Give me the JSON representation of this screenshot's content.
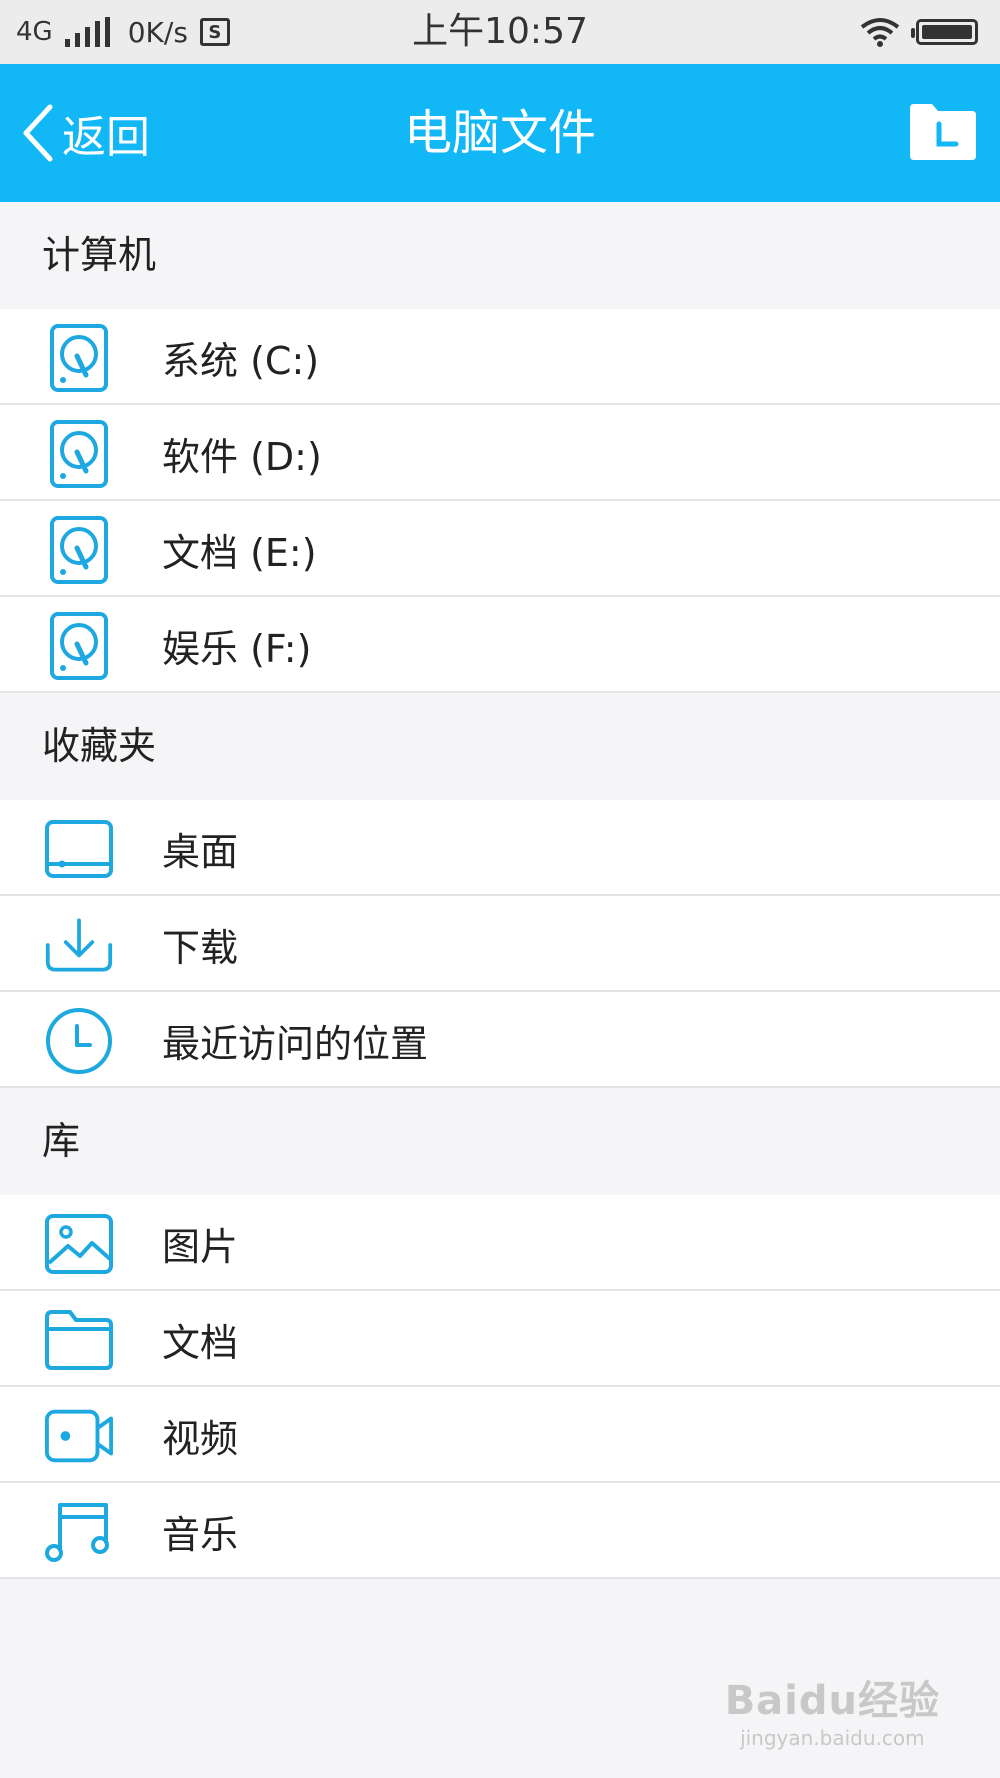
{
  "status_bar": {
    "network": "4G",
    "speed": "0K/s",
    "sim_icon_glyph": "S",
    "time": "上午10:57"
  },
  "nav": {
    "back_label": "返回",
    "title": "电脑文件",
    "folder_icon": "folder-clock-icon"
  },
  "colors": {
    "accent": "#12b7f5",
    "icon": "#1da9e0"
  },
  "sections": {
    "computer": {
      "title": "计算机",
      "items": [
        {
          "label": "系统 (C:)",
          "icon": "hard-drive-icon"
        },
        {
          "label": "软件 (D:)",
          "icon": "hard-drive-icon"
        },
        {
          "label": "文档 (E:)",
          "icon": "hard-drive-icon"
        },
        {
          "label": "娱乐 (F:)",
          "icon": "hard-drive-icon"
        }
      ]
    },
    "favorites": {
      "title": "收藏夹",
      "items": [
        {
          "label": "桌面",
          "icon": "desktop-icon"
        },
        {
          "label": "下载",
          "icon": "download-icon"
        },
        {
          "label": "最近访问的位置",
          "icon": "clock-icon"
        }
      ]
    },
    "library": {
      "title": "库",
      "items": [
        {
          "label": "图片",
          "icon": "picture-icon"
        },
        {
          "label": "文档",
          "icon": "folder-icon"
        },
        {
          "label": "视频",
          "icon": "video-icon"
        },
        {
          "label": "音乐",
          "icon": "music-icon"
        }
      ]
    }
  },
  "watermark": {
    "logo": "Baidu经验",
    "url": "jingyan.baidu.com"
  }
}
